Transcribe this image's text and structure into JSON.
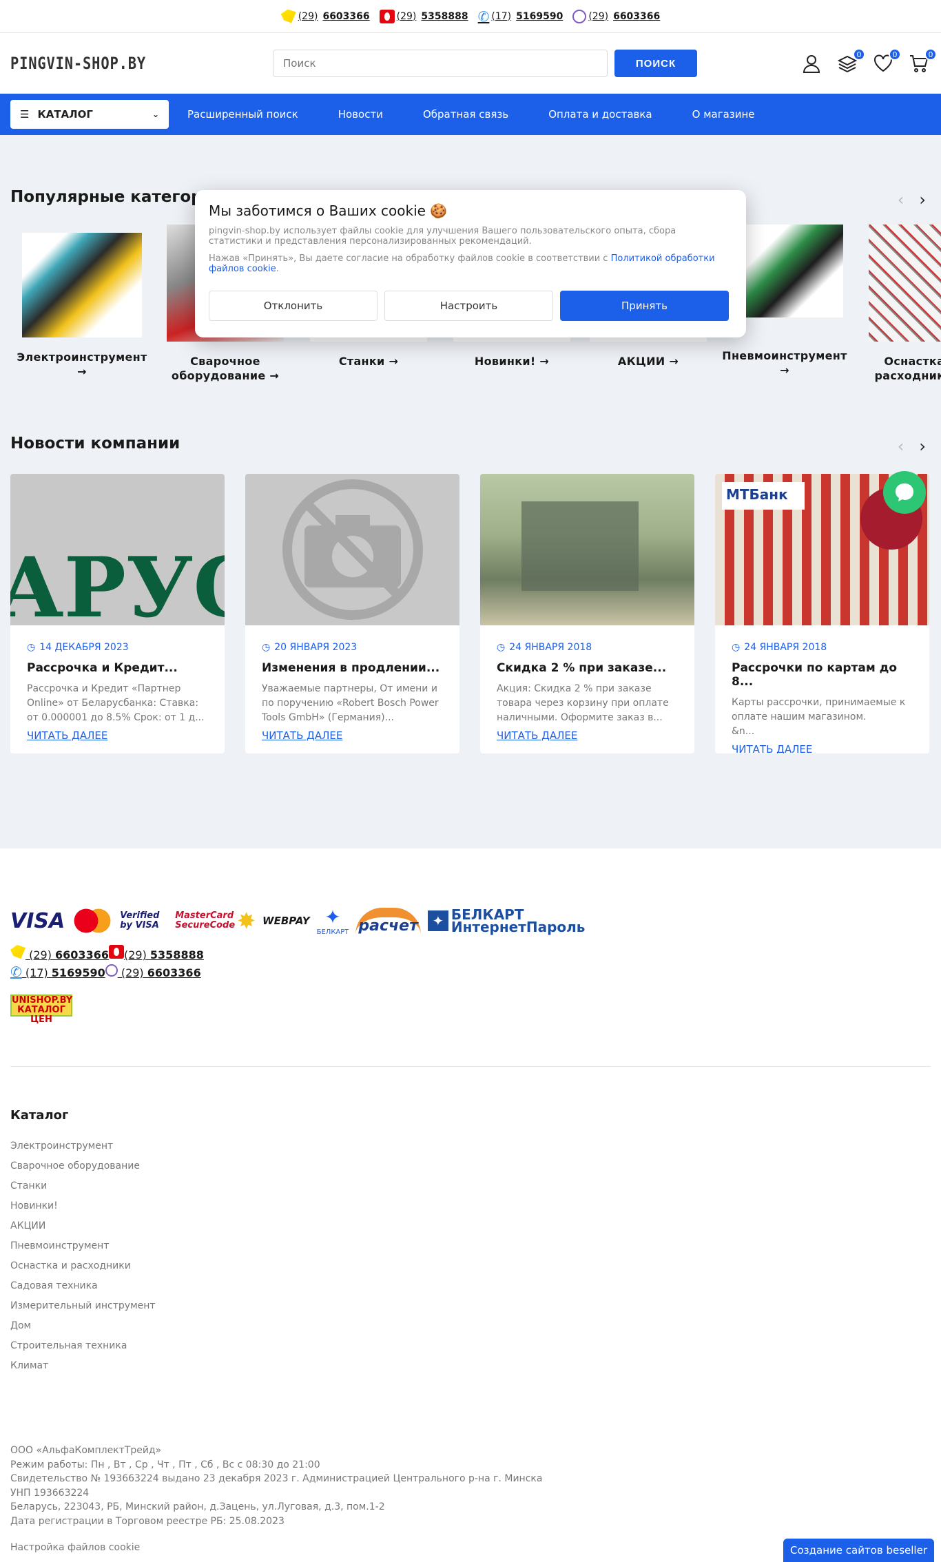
{
  "topbar": {
    "phones": [
      {
        "op": "a1-icon",
        "code": "(29)",
        "num": "6603366"
      },
      {
        "op": "mts-icon",
        "code": "(29)",
        "num": "5358888"
      },
      {
        "op": "phone-icon",
        "code": "(17)",
        "num": "5169590"
      },
      {
        "op": "viber-icon",
        "code": "(29)",
        "num": "6603366"
      }
    ]
  },
  "header": {
    "logo": "PINGVIN-SHOP.BY",
    "search_placeholder": "Поиск",
    "search_button": "ПОИСК",
    "compare_count": "0",
    "wishlist_count": "0",
    "cart_count": "0"
  },
  "nav": {
    "catalog": "КАТАЛОГ",
    "links": [
      "Расширенный поиск",
      "Новости",
      "Обратная связь",
      "Оплата и доставка",
      "О магазине"
    ]
  },
  "popular": {
    "title": "Популярные категории",
    "items": [
      "Электроинструмент",
      "Сварочное оборудование",
      "Станки",
      "Новинки!",
      "АКЦИИ",
      "Пневмоинструмент",
      "Оснастка и расходники"
    ]
  },
  "cookie": {
    "title": "Мы заботимся о Ваших cookie 🍪",
    "text1": "pingvin-shop.by использует файлы cookie для улучшения Вашего пользовательского опыта, сбора статистики и представления персонализированных рекомендаций.",
    "text2": "Нажав «Принять», Вы даете согласие на обработку файлов cookie в соответствии с ",
    "link": "Политикой обработки файлов cookie",
    "decline": "Отклонить",
    "settings": "Настроить",
    "accept": "Принять"
  },
  "news": {
    "title": "Новости компании",
    "read_more": "ЧИТАТЬ ДАЛЕЕ",
    "items": [
      {
        "date": "14 ДЕКАБРЯ 2023",
        "title": "Рассрочка и Кредит...",
        "desc": "Рассрочка и Кредит «Партнер Online» от Беларусбанка: Ставка: от 0.000001 до 8.5% Срок: от 1 д..."
      },
      {
        "date": "20 ЯНВАРЯ 2023",
        "title": "Изменения в продлении...",
        "desc": "Уважаемые партнеры, От имени и по поручению «Robert Bosch Power Tools GmbH» (Германия)..."
      },
      {
        "date": "24 ЯНВАРЯ 2018",
        "title": "Скидка 2 % при заказе...",
        "desc": "Акция: Скидка 2 % при заказе товара через корзину при оплате наличными. Оформите заказ в..."
      },
      {
        "date": "24 ЯНВАРЯ 2018",
        "title": "Рассрочки по картам до 8...",
        "desc": "Карты рассрочки, принимаемые к оплате нашим магазином.          &n..."
      }
    ]
  },
  "footer": {
    "pay_logos": [
      "VISA",
      "MasterCard",
      "Verified by VISA",
      "MasterCard SecureCode",
      "WEBPAY",
      "БЕЛКАРТ",
      "расчет",
      "БЕЛКАРТ ИнтернетПароль"
    ],
    "unishop": "UNISHOP.BY КАТАЛОГ ЦЕН",
    "catalog_title": "Каталог",
    "catalog_items": [
      "Электроинструмент",
      "Сварочное оборудование",
      "Станки",
      "Новинки!",
      "АКЦИИ",
      "Пневмоинструмент",
      "Оснастка и расходники",
      "Садовая техника",
      "Измерительный инструмент",
      "Дом",
      "Строительная техника",
      "Климат"
    ],
    "legal": [
      "ООО «АльфаКомплектТрейд»",
      "Режим работы: Пн , Вт , Ср , Чт , Пт , Сб , Вс с 08:30 до 21:00",
      "Свидетельство № 193663224 выдано 23 декабря 2023 г. Администрацией Центрального р-на г. Минска",
      "УНП 193663224",
      "Беларусь, 223043, РБ, Минский район, д.Зацень, ул.Луговая, д.3, пом.1-2",
      "Дата регистрации в Торговом реестре РБ: 25.08.2023"
    ],
    "cookie_settings": "Настройка файлов cookie",
    "beseller": "Создание сайтов beseller"
  }
}
